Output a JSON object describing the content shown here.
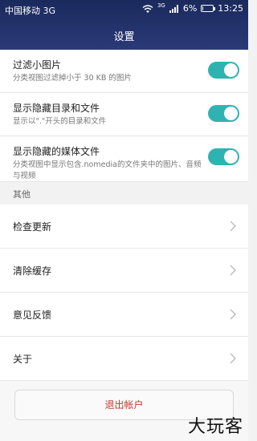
{
  "status_bar": {
    "carrier": "中国移动 3G",
    "network_tag": "3G",
    "battery_text": "6%",
    "battery_level": 0.06,
    "time": "13:25"
  },
  "header": {
    "title": "设置"
  },
  "toggles": [
    {
      "label": "过滤小图片",
      "sub": "分类视图过滤掉小于 30 KB 的图片",
      "on": true
    },
    {
      "label": "显示隐藏目录和文件",
      "sub": "显示以\".\"开头的目录和文件",
      "on": true
    },
    {
      "label": "显示隐藏的媒体文件",
      "sub": "分类视图中显示包含.nomedia的文件夹中的图片、音频与视频",
      "on": true
    }
  ],
  "group_other": {
    "title": "其他"
  },
  "list": [
    {
      "label": "检查更新"
    },
    {
      "label": "清除缓存"
    },
    {
      "label": "意见反馈"
    },
    {
      "label": "关于"
    }
  ],
  "logout_label": "退出帐户",
  "watermark": "大玩客",
  "colors": {
    "accent": "#2fb3b0",
    "header": "#1a2a5c",
    "logout_text": "#c0392b"
  },
  "icons": [
    "wifi-icon",
    "signal-icon",
    "battery-icon",
    "chevron-right-icon"
  ]
}
